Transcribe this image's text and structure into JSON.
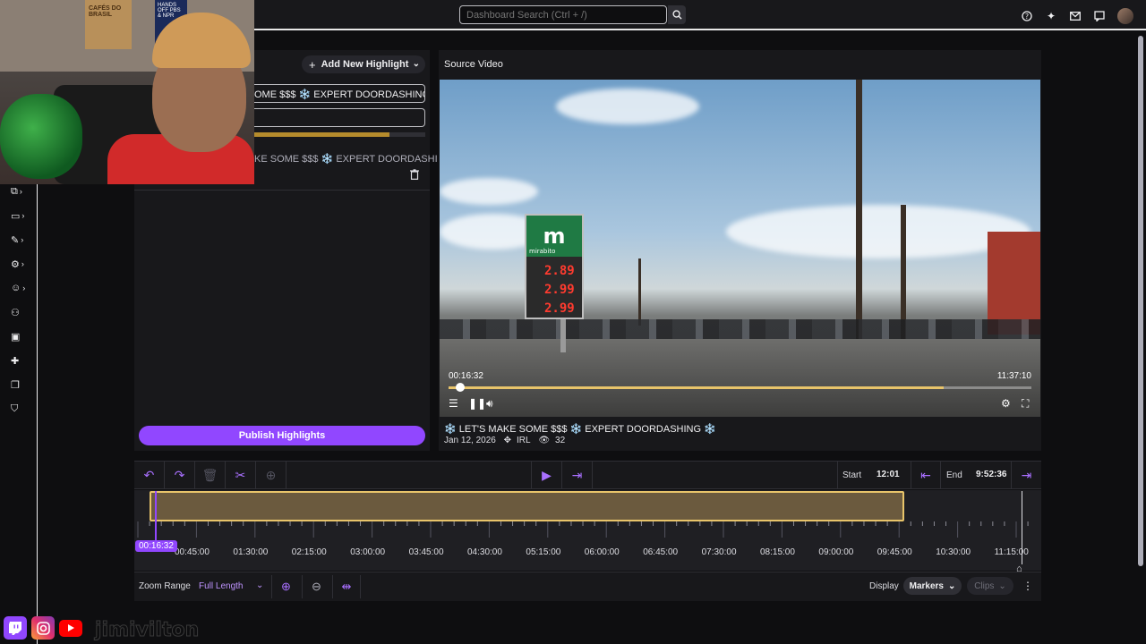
{
  "topbar": {
    "search_placeholder": "Dashboard Search (Ctrl + /)"
  },
  "sidenav": {
    "items": [
      {
        "icon": "clips-icon"
      },
      {
        "icon": "stream-manager-icon"
      },
      {
        "icon": "brush-icon"
      },
      {
        "icon": "settings-icon"
      },
      {
        "icon": "emote-icon"
      },
      {
        "icon": "community-icon"
      },
      {
        "icon": "video-icon"
      },
      {
        "icon": "extensions-icon"
      },
      {
        "icon": "learn-icon"
      },
      {
        "icon": "safety-icon"
      }
    ]
  },
  "webcam": {
    "poster_text": "CAFÉS DO BRASIL",
    "sign_text": "HANDS OFF PBS & NPR"
  },
  "highlights": {
    "add_button": "Add New Highlight",
    "title_value": "OME $$$ ❄️ EXPERT DOORDASHING ❄️",
    "list_item_title": "KE SOME $$$ ❄️ EXPERT DOORDASHI…",
    "publish_button": "Publish Highlights",
    "bar_fraction": 0.79
  },
  "video": {
    "source_label": "Source Video",
    "current_time": "00:16:32",
    "duration": "11:37:10",
    "progress_fraction": 0.02,
    "buffered_fraction": 0.85,
    "brand": "m",
    "brand_name": "mirabito",
    "gas_prices": [
      "2.89",
      "2.99",
      "2.99"
    ],
    "title": "❄️ LET'S MAKE SOME $$$ ❄️ EXPERT DOORDASHING ❄️",
    "date": "Jan 12, 2026",
    "category": "IRL",
    "views": "32"
  },
  "timeline": {
    "start_label": "Start",
    "start_value": "12:01",
    "end_label": "End",
    "end_value": "9:52:36",
    "playhead": "00:16:32",
    "ticks": [
      "00:45:00",
      "01:30:00",
      "02:15:00",
      "03:00:00",
      "03:45:00",
      "04:30:00",
      "05:15:00",
      "06:00:00",
      "06:45:00",
      "07:30:00",
      "08:15:00",
      "09:00:00",
      "09:45:00",
      "10:30:00",
      "11:15:00"
    ],
    "zoom_label": "Zoom Range",
    "zoom_value": "Full Length",
    "display_label": "Display",
    "markers": "Markers",
    "clips": "Clips"
  },
  "overlay": {
    "handle": "jimivilton"
  },
  "colors": {
    "accent": "#9147ff",
    "clip_fill": "#6b5a3e",
    "clip_border": "#e8c46a"
  }
}
